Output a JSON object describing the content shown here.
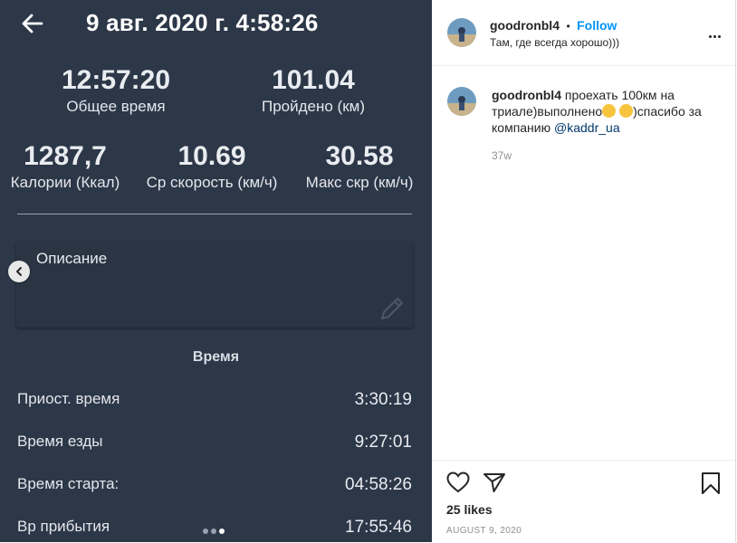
{
  "photo": {
    "title": "9 авг. 2020 г. 4:58:26",
    "stats_top": [
      {
        "value": "12:57:20",
        "label": "Общее время"
      },
      {
        "value": "101.04",
        "label": "Пройдено (км)"
      }
    ],
    "stats_mid": [
      {
        "value": "1287,7",
        "label": "Калории (Ккал)"
      },
      {
        "value": "10.69",
        "label": "Ср скорость (км/ч)"
      },
      {
        "value": "30.58",
        "label": "Макс скр (км/ч)"
      }
    ],
    "description_label": "Описание",
    "section_title": "Время",
    "rows": [
      {
        "label": "Приост. время",
        "value": "3:30:19"
      },
      {
        "label": "Время езды",
        "value": "9:27:01"
      },
      {
        "label": "Время старта:",
        "value": "04:58:26"
      },
      {
        "label": "Вр прибытия",
        "value": "17:55:46"
      }
    ],
    "carousel": {
      "count": 3,
      "active": 3
    }
  },
  "post": {
    "username": "goodronbl4",
    "follow_label": "Follow",
    "location": "Там, где всегда хорошо)))",
    "caption_before": "проехать 100км на триале)выполнено",
    "caption_after": ")спасибо за компанию",
    "mention": "@kaddr_ua",
    "time_ago": "37w",
    "likes": "25 likes",
    "date": "AUGUST 9, 2020"
  },
  "colors": {
    "photo_bg": "#2c3748",
    "follow": "#0095f6",
    "mention": "#00376b"
  },
  "icons": [
    "back-arrow-icon",
    "pencil-icon",
    "chevron-left-icon",
    "more-icon",
    "heart-icon",
    "share-icon",
    "bookmark-icon",
    "emoji-icon"
  ]
}
